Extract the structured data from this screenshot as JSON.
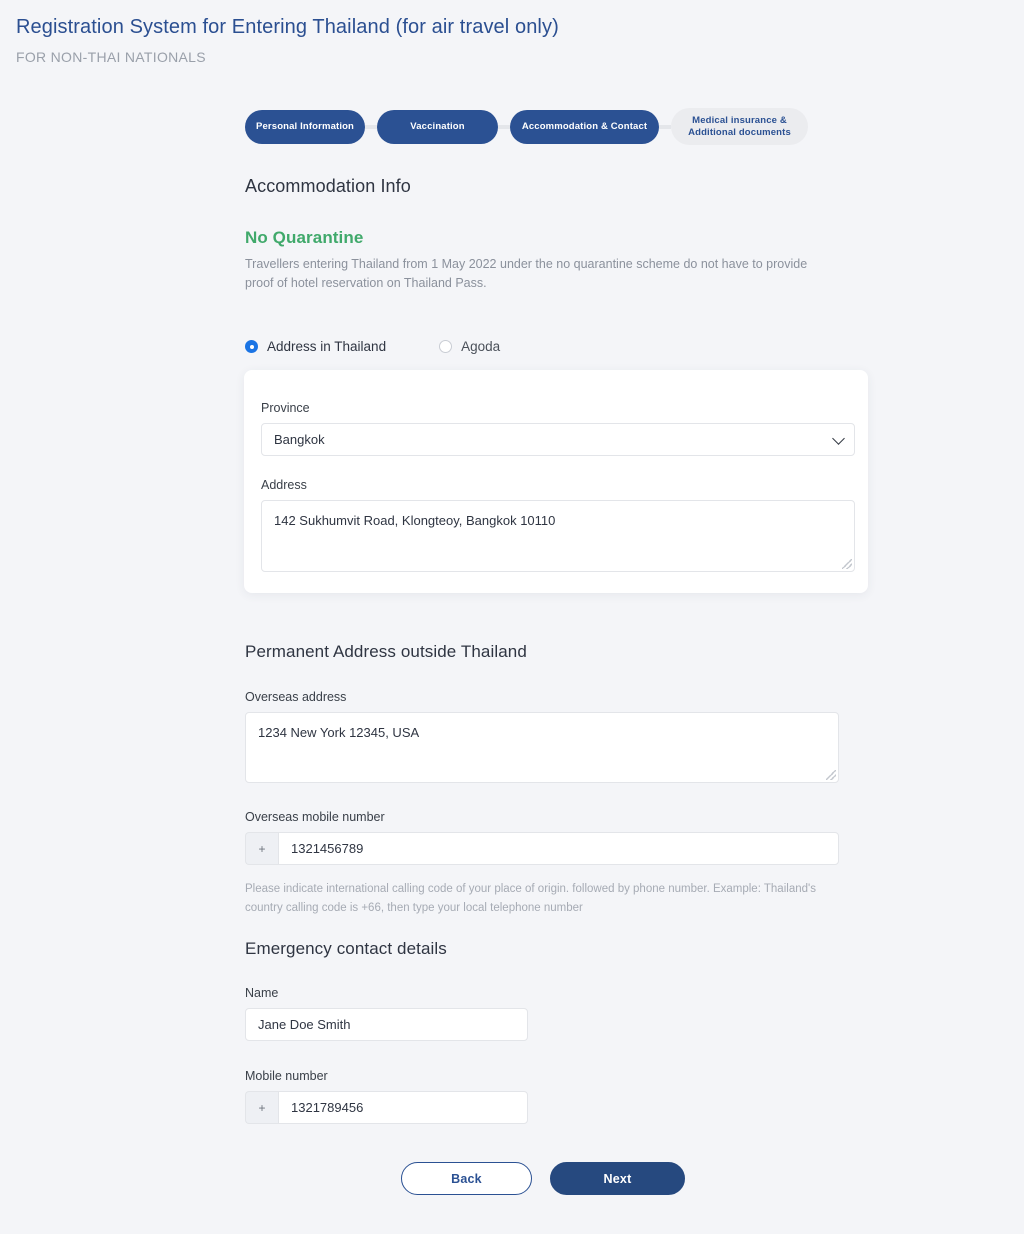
{
  "header": {
    "title": "Registration System for Entering Thailand (for air travel only)",
    "subtitle": "FOR NON-THAI NATIONALS",
    "title_color": "#2b4f91",
    "subtitle_color": "#9aa0aa"
  },
  "stepper": {
    "steps": [
      {
        "label": "Personal Information",
        "state": "done"
      },
      {
        "label": "Vaccination",
        "state": "done"
      },
      {
        "label": "Accommodation & Contact",
        "state": "active"
      },
      {
        "label": "Medical insurance & Additional documents",
        "state": "upcoming"
      }
    ],
    "active_color": "#2b5193",
    "inactive_bg": "#ebecef",
    "inactive_text": "#2b5193"
  },
  "accommodation": {
    "section_title": "Accommodation Info",
    "quarantine_title": "No Quarantine",
    "quarantine_color": "#40a96b",
    "quarantine_description": "Travellers entering Thailand from 1 May 2022 under the no quarantine scheme do not have to provide proof of hotel reservation on Thailand Pass.",
    "options": [
      {
        "label": "Address in Thailand",
        "selected": true
      },
      {
        "label": "Agoda",
        "selected": false
      }
    ],
    "selected_color": "#1b74e4",
    "province": {
      "label": "Province",
      "value": "Bangkok",
      "options": [
        "Bangkok"
      ]
    },
    "address": {
      "label": "Address",
      "value": "142 Sukhumvit Road, Klongteoy, Bangkok 10110",
      "placeholder": ""
    }
  },
  "permanent_address": {
    "heading": "Permanent Address outside Thailand",
    "overseas_address": {
      "label": "Overseas address",
      "value": "1234 New York 12345, USA",
      "placeholder": ""
    },
    "overseas_mobile": {
      "label": "Overseas mobile number",
      "prefix": "+",
      "value": "1321456789",
      "placeholder": ""
    },
    "helper_text": "Please indicate international calling code of your place of origin. followed by phone number. Example: Thailand's country calling code is +66, then type your local telephone number"
  },
  "emergency_contact": {
    "heading": "Emergency contact details",
    "name": {
      "label": "Name",
      "value": "Jane Doe Smith",
      "placeholder": ""
    },
    "mobile": {
      "label": "Mobile number",
      "prefix": "+",
      "value": "1321789456",
      "placeholder": ""
    }
  },
  "footer": {
    "back_label": "Back",
    "next_label": "Next",
    "back_color": "#2b5193",
    "next_color": "#26497f"
  }
}
